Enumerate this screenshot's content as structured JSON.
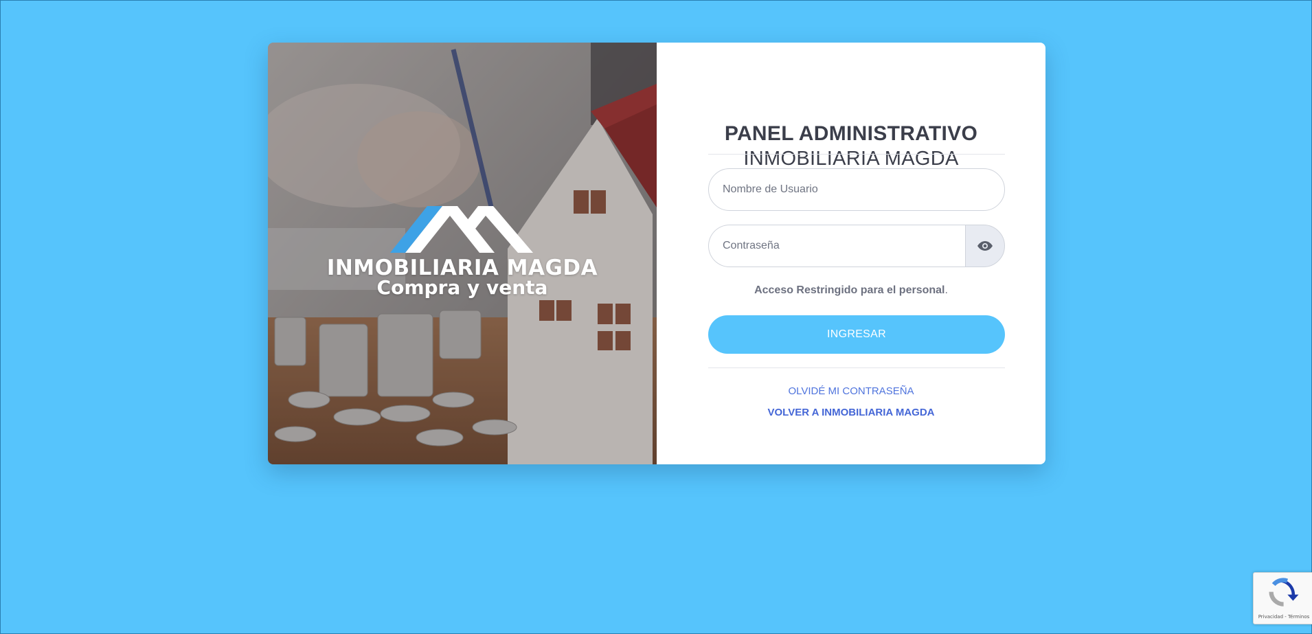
{
  "hero": {
    "brand": "INMOBILIARIA MAGDA",
    "tagline": "Compra y venta"
  },
  "panel": {
    "title_line1": "PANEL ADMINISTRATIVO",
    "title_line2": "INMOBILIARIA MAGDA",
    "username_placeholder": "Nombre de Usuario",
    "password_placeholder": "Contraseña",
    "restricted_bold": "Acceso Restringido para el personal",
    "restricted_end": ".",
    "submit_label": "INGRESAR",
    "forgot_label": "OLVIDÉ MI CONTRASEÑA",
    "back_label": "VOLVER A INMOBILIARIA MAGDA",
    "eye_icon": "eye-icon"
  },
  "recaptcha": {
    "terms": "Privacidad - Términos"
  },
  "colors": {
    "background": "#56c4fc",
    "accent": "#56c4fc",
    "link": "#4f74dd",
    "text_dark": "#3b3e4a"
  }
}
